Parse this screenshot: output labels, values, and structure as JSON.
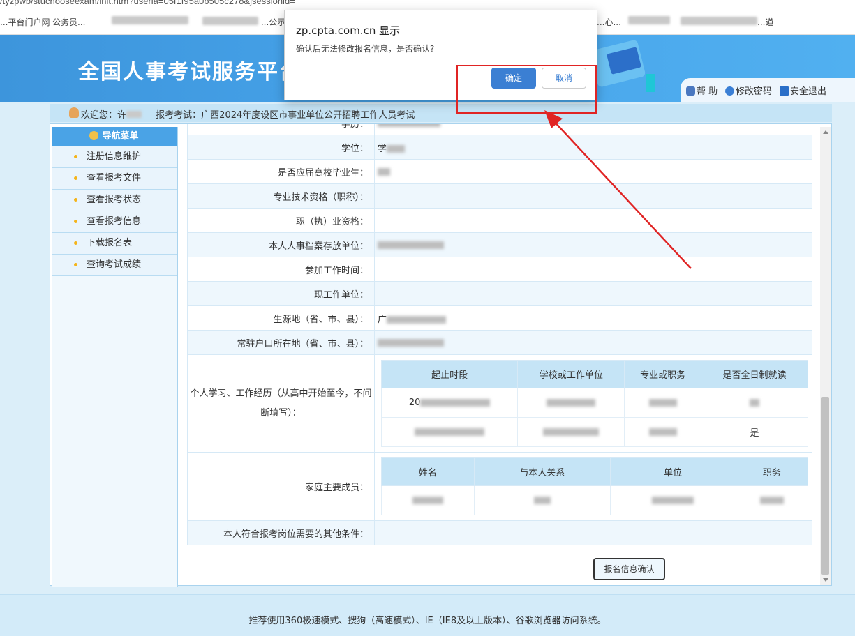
{
  "browser": {
    "url": "/tyzpwb/stuchooseexam/init.htm?useria=05f1f95a0b505c278&jsessionid=",
    "bookmarks": [
      "...平台门户网",
      "公务员...",
      "...",
      "...公示",
      "...心...",
      "...",
      "...道"
    ]
  },
  "header": {
    "site_title": "全国人事考试服务平台",
    "help": "帮 助",
    "change_password": "修改密码",
    "logout": "安全退出"
  },
  "welcome": {
    "greeting": "欢迎您：许",
    "exam_label": "报考考试：",
    "exam_name": "广西2024年度设区市事业单位公开招聘工作人员考试"
  },
  "nav": {
    "title": "导航菜单",
    "items": [
      "注册信息维护",
      "查看报考文件",
      "查看报考状态",
      "查看报考信息",
      "下载报名表",
      "查询考试成绩"
    ]
  },
  "form": {
    "rows": [
      {
        "label": "学历：",
        "value": ""
      },
      {
        "label": "学位：",
        "value": "学"
      },
      {
        "label": "是否应届高校毕业生：",
        "value": ""
      },
      {
        "label": "专业技术资格（职称）：",
        "value": ""
      },
      {
        "label": "职（执）业资格：",
        "value": ""
      },
      {
        "label": "本人人事档案存放单位：",
        "value": ""
      },
      {
        "label": "参加工作时间：",
        "value": ""
      },
      {
        "label": "现工作单位：",
        "value": ""
      },
      {
        "label": "生源地（省、市、县）：",
        "value": "广"
      },
      {
        "label": "常驻户口所在地（省、市、县）：",
        "value": ""
      }
    ],
    "experience_label": "个人学习、工作经历（从高中开始至今，不间断填写）：",
    "experience_headers": [
      "起止时段",
      "学校或工作单位",
      "专业或职务",
      "是否全日制就读"
    ],
    "experience_rows": [
      [
        "20",
        "",
        "",
        ""
      ],
      [
        "",
        "",
        "",
        "是"
      ]
    ],
    "family_label": "家庭主要成员：",
    "family_headers": [
      "姓名",
      "与本人关系",
      "单位",
      "职务"
    ],
    "other_label": "本人符合报考岗位需要的其他条件：",
    "confirm_button": "报名信息确认"
  },
  "footer": {
    "text": "推荐使用360极速模式、搜狗（高速模式）、IE（IE8及以上版本）、谷歌浏览器访问系统。"
  },
  "dialog": {
    "origin": "zp.cpta.com.cn 显示",
    "message": "确认后无法修改报名信息，是否确认?",
    "ok": "确定",
    "cancel": "取消"
  },
  "colors": {
    "header_blue": "#47a4ea",
    "dialog_ok": "#3b7fd3",
    "annotation_red": "#e02424"
  }
}
